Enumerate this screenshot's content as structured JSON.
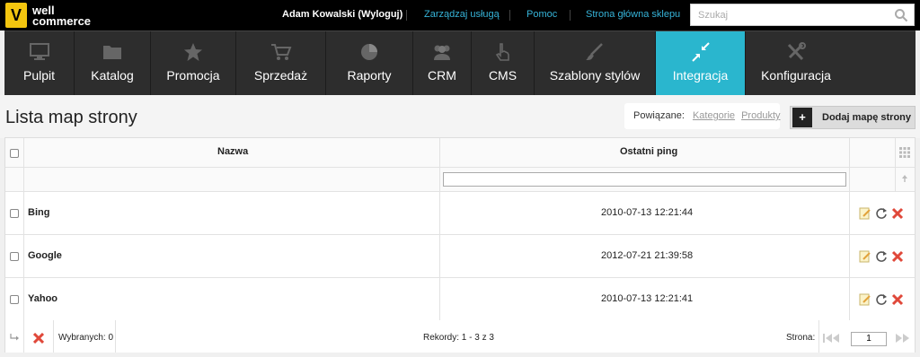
{
  "brand": {
    "mark": "V",
    "line1": "well",
    "line2": "commerce"
  },
  "topbar": {
    "user": "Adam Kowalski",
    "logout": "(Wyloguj)",
    "links": [
      "Zarządzaj usługą",
      "Pomoc",
      "Strona główna sklepu"
    ],
    "search_placeholder": "Szukaj"
  },
  "nav": {
    "items": [
      {
        "label": "Pulpit",
        "icon": "monitor-icon"
      },
      {
        "label": "Katalog",
        "icon": "folder-icon"
      },
      {
        "label": "Promocja",
        "icon": "star-icon"
      },
      {
        "label": "Sprzedaż",
        "icon": "cart-icon"
      },
      {
        "label": "Raporty",
        "icon": "pie-chart-icon"
      },
      {
        "label": "CRM",
        "icon": "users-icon"
      },
      {
        "label": "CMS",
        "icon": "hand-pointer-icon"
      },
      {
        "label": "Szablony stylów",
        "icon": "brush-icon"
      },
      {
        "label": "Integracja",
        "icon": "arrows-in-icon"
      },
      {
        "label": "Konfiguracja",
        "icon": "tools-icon"
      }
    ],
    "active": "Integracja",
    "active_color": "#2ab6ce"
  },
  "page": {
    "title": "Lista map strony",
    "related_label": "Powiązane:",
    "related_links": [
      "Kategorie",
      "Produkty"
    ],
    "add_button": "+",
    "add_label": "Dodaj mapę strony"
  },
  "grid": {
    "columns": [
      "Nazwa",
      "Ostatni ping"
    ],
    "rows": [
      {
        "name": "Bing",
        "ping": "2010-07-13 12:21:44"
      },
      {
        "name": "Google",
        "ping": "2012-07-21 21:39:58"
      },
      {
        "name": "Yahoo",
        "ping": "2010-07-13 12:21:41"
      }
    ]
  },
  "footer": {
    "selected": "Wybranych: 0",
    "records": "Rekordy: 1 - 3 z 3",
    "page_label": "Strona:",
    "page_value": "1"
  }
}
